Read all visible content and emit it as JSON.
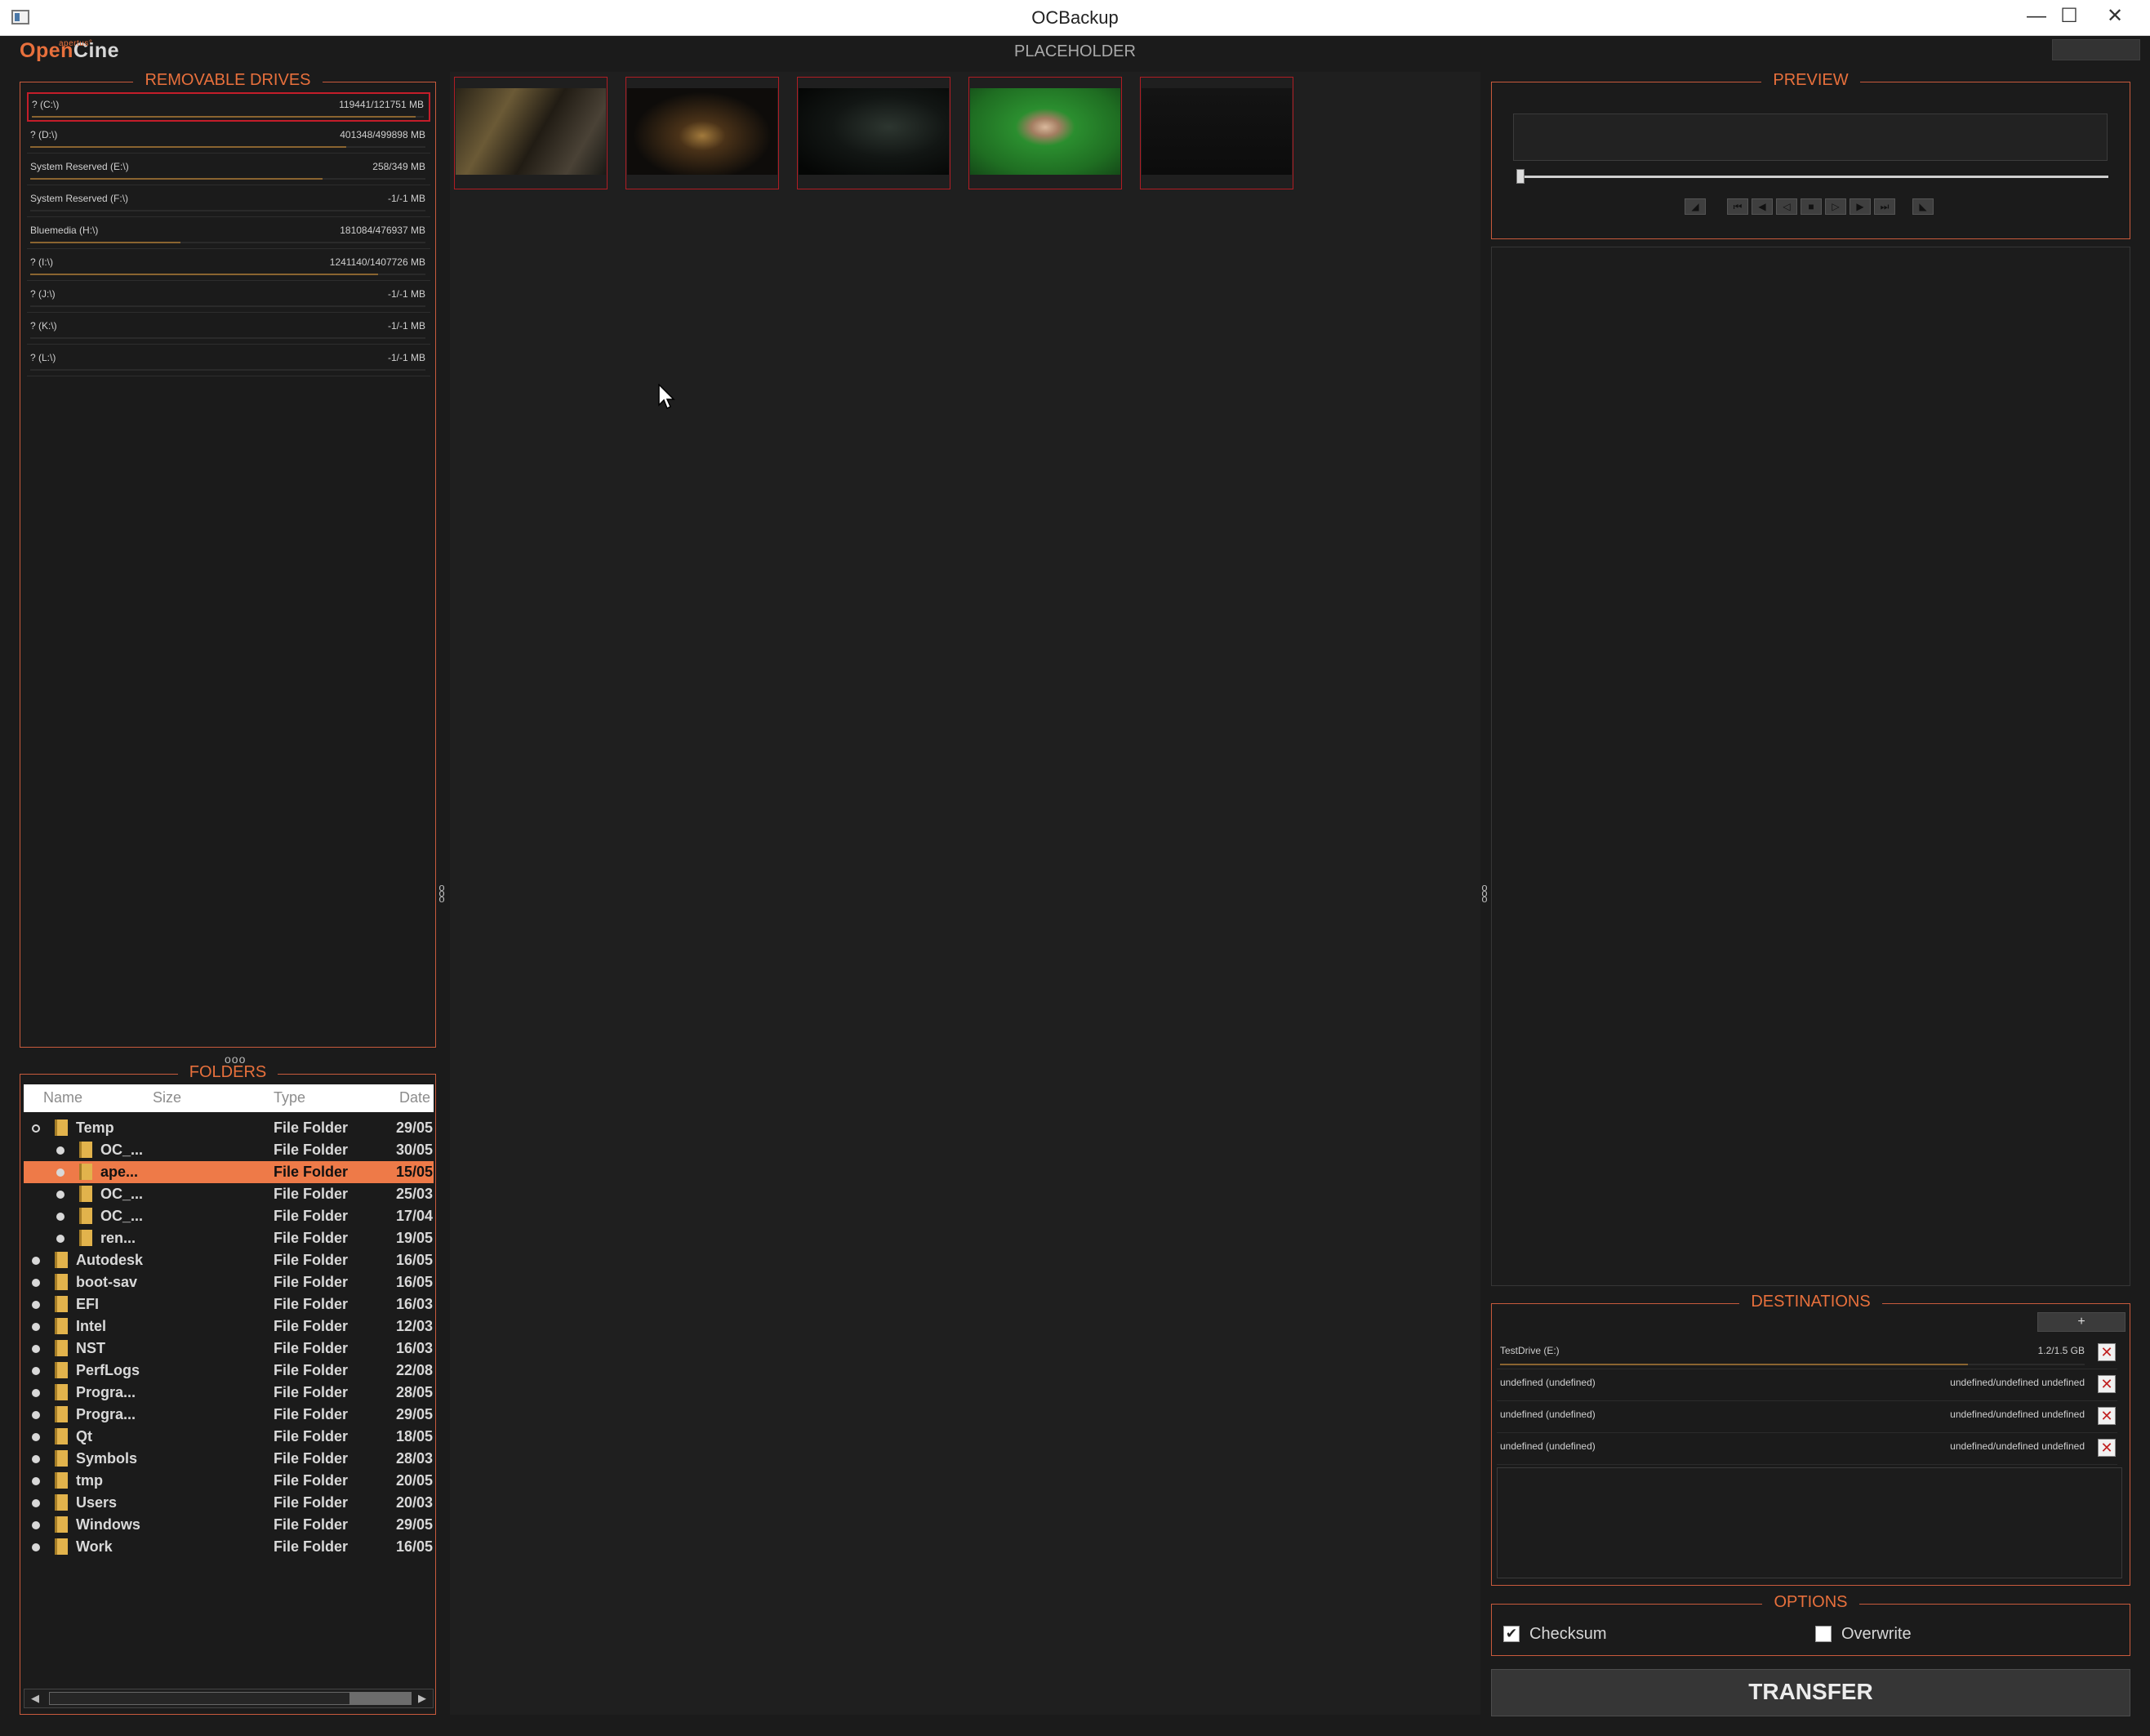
{
  "window": {
    "title": "OCBackup",
    "min": "—",
    "max": "☐",
    "close": "✕"
  },
  "header": {
    "logo_small": "apertus°",
    "logo_open": "Open",
    "logo_cine": "Cine",
    "title": "PLACEHOLDER"
  },
  "drives": {
    "title": "REMOVABLE DRIVES",
    "items": [
      {
        "name": "? (C:\\)",
        "size": "119441/121751 MB",
        "used": 0.98,
        "selected": true
      },
      {
        "name": "? (D:\\)",
        "size": "401348/499898 MB",
        "used": 0.8
      },
      {
        "name": "System Reserved (E:\\)",
        "size": "258/349 MB",
        "used": 0.74
      },
      {
        "name": "System Reserved (F:\\)",
        "size": "-1/-1 MB",
        "used": 0
      },
      {
        "name": "Bluemedia (H:\\)",
        "size": "181084/476937 MB",
        "used": 0.38
      },
      {
        "name": "? (I:\\)",
        "size": "1241140/1407726 MB",
        "used": 0.88
      },
      {
        "name": "? (J:\\)",
        "size": "-1/-1 MB",
        "used": 0
      },
      {
        "name": "? (K:\\)",
        "size": "-1/-1 MB",
        "used": 0
      },
      {
        "name": "? (L:\\)",
        "size": "-1/-1 MB",
        "used": 0
      }
    ]
  },
  "folders": {
    "title": "FOLDERS",
    "columns": {
      "name": "Name",
      "size": "Size",
      "type": "Type",
      "date": "Date"
    },
    "rows": [
      {
        "name": "Temp",
        "type": "File Folder",
        "date": "29/05",
        "level": 0,
        "open": true
      },
      {
        "name": "OC_...",
        "type": "File Folder",
        "date": "30/05",
        "level": 1
      },
      {
        "name": "ape...",
        "type": "File Folder",
        "date": "15/05",
        "level": 1,
        "selected": true
      },
      {
        "name": "OC_...",
        "type": "File Folder",
        "date": "25/03",
        "level": 1
      },
      {
        "name": "OC_...",
        "type": "File Folder",
        "date": "17/04",
        "level": 1
      },
      {
        "name": "ren...",
        "type": "File Folder",
        "date": "19/05",
        "level": 1
      },
      {
        "name": "Autodesk",
        "type": "File Folder",
        "date": "16/05",
        "level": 0
      },
      {
        "name": "boot-sav",
        "type": "File Folder",
        "date": "16/05",
        "level": 0
      },
      {
        "name": "EFI",
        "type": "File Folder",
        "date": "16/03",
        "level": 0
      },
      {
        "name": "Intel",
        "type": "File Folder",
        "date": "12/03",
        "level": 0
      },
      {
        "name": "NST",
        "type": "File Folder",
        "date": "16/03",
        "level": 0
      },
      {
        "name": "PerfLogs",
        "type": "File Folder",
        "date": "22/08",
        "level": 0
      },
      {
        "name": "Progra...",
        "type": "File Folder",
        "date": "28/05",
        "level": 0
      },
      {
        "name": "Progra...",
        "type": "File Folder",
        "date": "29/05",
        "level": 0
      },
      {
        "name": "Qt",
        "type": "File Folder",
        "date": "18/05",
        "level": 0
      },
      {
        "name": "Symbols",
        "type": "File Folder",
        "date": "28/03",
        "level": 0
      },
      {
        "name": "tmp",
        "type": "File Folder",
        "date": "20/05",
        "level": 0
      },
      {
        "name": "Users",
        "type": "File Folder",
        "date": "20/03",
        "level": 0
      },
      {
        "name": "Windows",
        "type": "File Folder",
        "date": "29/05",
        "level": 0
      },
      {
        "name": "Work",
        "type": "File Folder",
        "date": "16/05",
        "level": 0
      }
    ]
  },
  "preview": {
    "title": "PREVIEW",
    "position": 0.0
  },
  "destinations": {
    "title": "DESTINATIONS",
    "add_label": "+",
    "items": [
      {
        "name": "TestDrive (E:)",
        "size": "1.2/1.5 GB",
        "used": 0.8
      },
      {
        "name": "undefined (undefined)",
        "size": "undefined/undefined undefined",
        "used": 0
      },
      {
        "name": "undefined (undefined)",
        "size": "undefined/undefined undefined",
        "used": 0
      },
      {
        "name": "undefined (undefined)",
        "size": "undefined/undefined undefined",
        "used": 0
      }
    ],
    "remove_label": "✕"
  },
  "options": {
    "title": "OPTIONS",
    "checksum_label": "Checksum",
    "checksum": true,
    "overwrite_label": "Overwrite",
    "overwrite": false
  },
  "transfer_label": "TRANSFER",
  "colors": {
    "accent": "#e8703c",
    "selection": "#ee7a48",
    "thumb_border": "#b01d24"
  }
}
